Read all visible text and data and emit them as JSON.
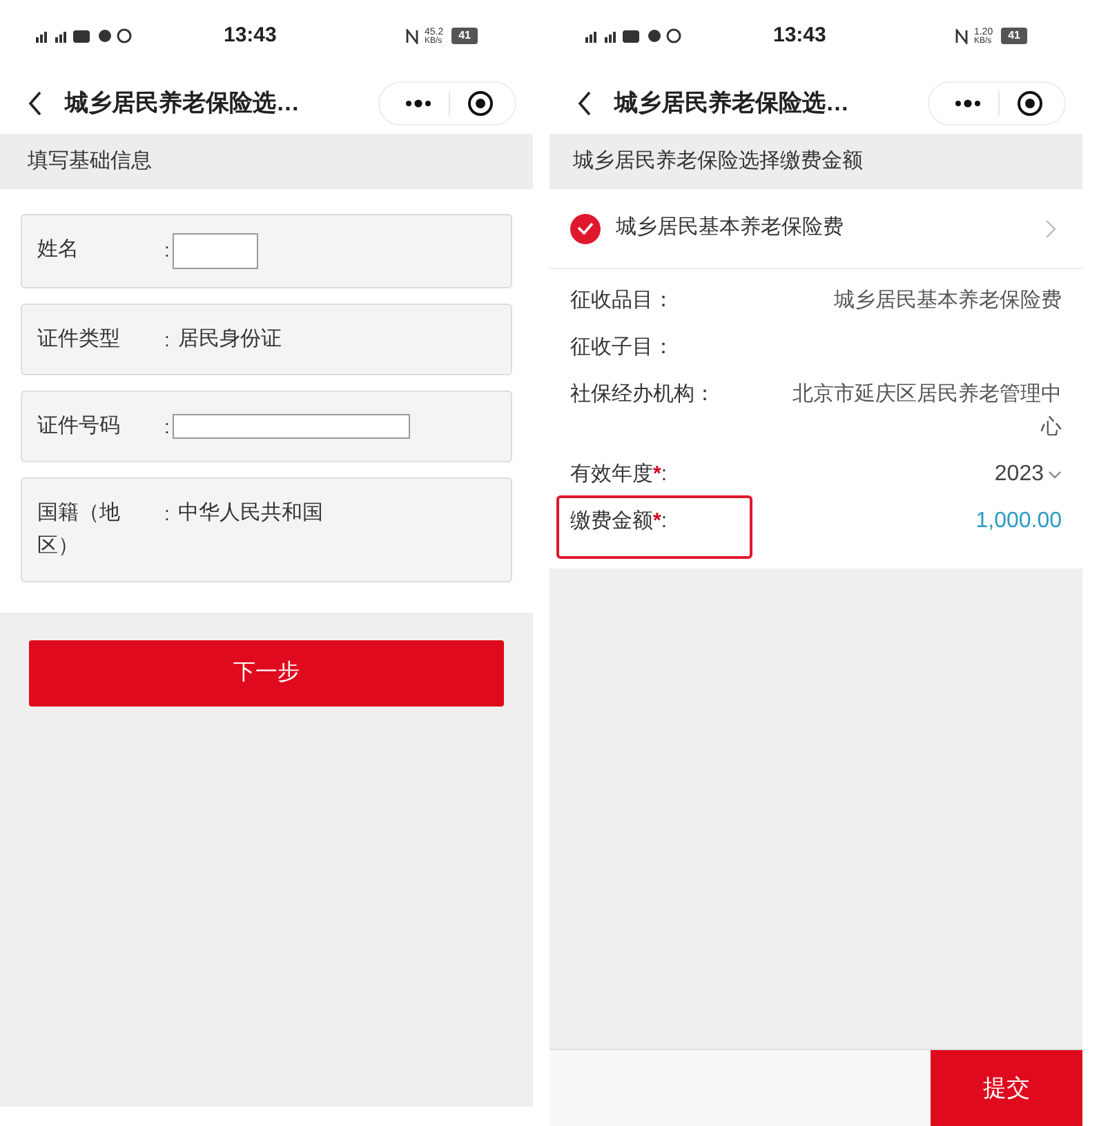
{
  "form_screen": {
    "status_bar": {
      "time": "13:43",
      "speed": "45.2",
      "speed_unit": "KB/s",
      "battery": "41"
    },
    "nav": {
      "title": "城乡居民养老保险选…"
    },
    "section_title": "填写基础信息",
    "fields": [
      {
        "label": "姓名",
        "colon": ":",
        "kind": "input"
      },
      {
        "label": "证件类型",
        "colon": ":",
        "kind": "text",
        "value": "居民身份证"
      },
      {
        "label": "证件号码",
        "colon": ":",
        "kind": "wideinput"
      },
      {
        "label": "国籍（地区）",
        "colon": ":",
        "kind": "text",
        "value": "中华人民共和国"
      }
    ],
    "next_button": "下一步"
  },
  "payment_screen": {
    "status_bar": {
      "time": "13:43",
      "speed": "1.20",
      "speed_unit": "KB/s",
      "battery": "41"
    },
    "nav": {
      "title": "城乡居民养老保险选…"
    },
    "section_title": "城乡居民养老保险选择缴费金额",
    "item": {
      "label": "城乡居民基本养老保险费",
      "checked": true
    },
    "details": [
      {
        "label": "征收品目",
        "colon": "：",
        "kind": "text",
        "value": "城乡居民基本养老保险费",
        "highlighted": false
      },
      {
        "label": "征收子目",
        "colon": "：",
        "kind": "text",
        "highlighted": false
      },
      {
        "label": "社保经办机构",
        "colon": "：",
        "kind": "text",
        "value": "北京市延庆区居民养老管理中心",
        "highlighted": false
      },
      {
        "label": "有效年度",
        "required_mark": "*",
        "colon": ":",
        "kind": "select",
        "value": "2023",
        "highlighted": false
      },
      {
        "label": "缴费金额",
        "required_mark": "*",
        "colon": ":",
        "kind": "amount",
        "value": "1,000.00",
        "highlighted": true
      }
    ],
    "submit_button": "提交"
  }
}
